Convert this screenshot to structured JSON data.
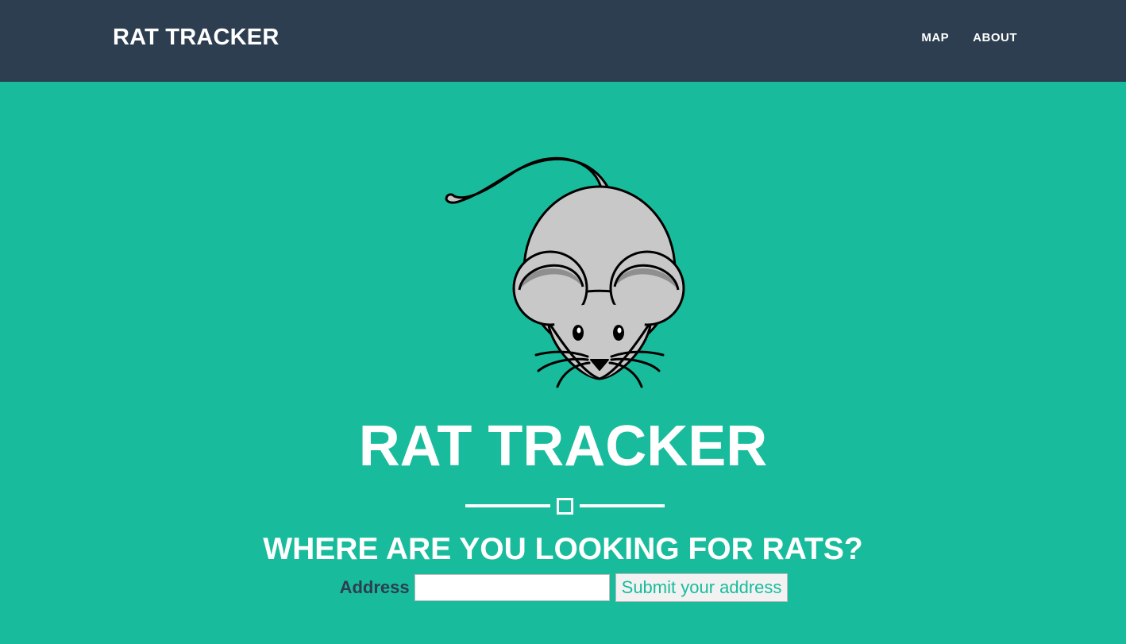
{
  "navbar": {
    "brand": "RAT TRACKER",
    "links": [
      {
        "label": "MAP"
      },
      {
        "label": "ABOUT"
      }
    ]
  },
  "hero": {
    "title": "RAT TRACKER",
    "subheading": "WHERE ARE YOU LOOKING FOR RATS?",
    "mascot_icon": "rat-icon"
  },
  "form": {
    "address_label": "Address",
    "address_value": "",
    "address_placeholder": "",
    "submit_label": "Submit your address"
  },
  "colors": {
    "navbar_bg": "#2c3e50",
    "page_bg": "#18bc9c",
    "label_text": "#2c3e50",
    "button_text": "#18bc9c"
  }
}
